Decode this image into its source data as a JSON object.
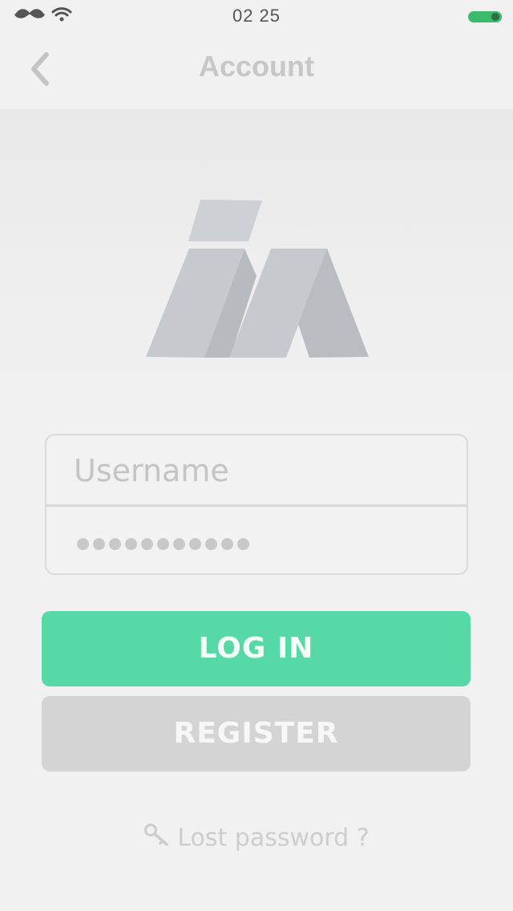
{
  "status_bar": {
    "time": "02 25",
    "battery_color": "#3dbb6c"
  },
  "nav": {
    "title": "Account",
    "back_icon": "chevron-left-icon"
  },
  "form": {
    "username_placeholder": "Username",
    "password_dots": 11
  },
  "buttons": {
    "login_label": "LOG IN",
    "register_label": "REGISTER"
  },
  "lost_password": {
    "label": "Lost password ?",
    "icon": "key-icon"
  },
  "colors": {
    "accent": "#57d9a7",
    "secondary_button": "#d4d4d4",
    "logo": "#c6cacf"
  }
}
